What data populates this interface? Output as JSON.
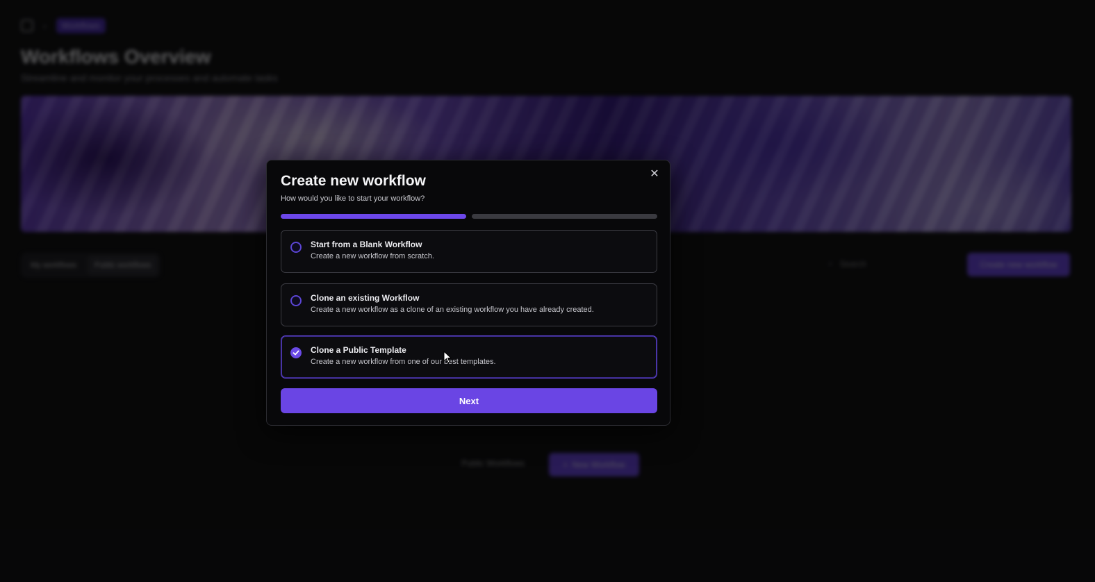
{
  "background": {
    "breadcrumb_active": "Workflows",
    "title": "Workflows Overview",
    "subtitle": "Streamline and monitor your processes and automate tasks",
    "tabs": [
      "My workflows",
      "Public workflows"
    ],
    "search_placeholder": "Search",
    "create_button": "Create new workflow",
    "empty_text": "",
    "public_link": "Public Workflows",
    "new_button": "New Workflow"
  },
  "modal": {
    "title": "Create new workflow",
    "subtitle": "How would you like to start your workflow?",
    "progress": {
      "current_step": 1,
      "total_steps": 2
    },
    "options": [
      {
        "title": "Start from a Blank Workflow",
        "description": "Create a new workflow from scratch.",
        "selected": false
      },
      {
        "title": "Clone an existing Workflow",
        "description": "Create a new workflow as a clone of an existing workflow you have already created.",
        "selected": false
      },
      {
        "title": "Clone a Public Template",
        "description": "Create a new workflow from one of our best templates.",
        "selected": true
      }
    ],
    "next_label": "Next"
  },
  "colors": {
    "accent": "#6a45e4",
    "background": "#0b0b0c",
    "modal_bg": "#08080a"
  }
}
